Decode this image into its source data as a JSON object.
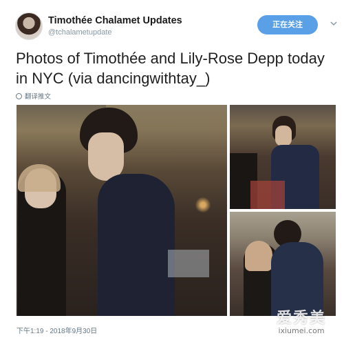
{
  "account": {
    "name": "Timothée Chalamet Updates",
    "handle": "@tchalametupdate",
    "follow_label": "正在关注"
  },
  "tweet": {
    "text": "Photos of Timothée and Lily-Rose Depp today in NYC (via dancingwithtay_)",
    "translate_label": "翻译推文",
    "timestamp": "下午1:19 - 2018年9月30日"
  },
  "photos": [
    {
      "name": "main-photo",
      "description_icon": "photo"
    },
    {
      "name": "top-right-photo",
      "description_icon": "photo"
    },
    {
      "name": "bottom-right-photo",
      "description_icon": "photo"
    }
  ],
  "watermark": {
    "title": "爱秀美",
    "url": "ixiumei.com"
  },
  "colors": {
    "follow_button": "#5aa0e6",
    "text": "#14171a",
    "muted": "#657786"
  }
}
